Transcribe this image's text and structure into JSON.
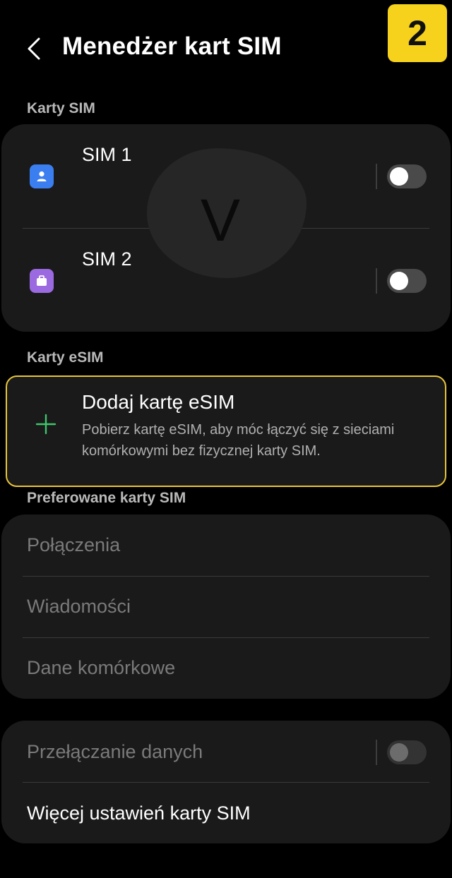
{
  "header": {
    "title": "Menedżer kart SIM",
    "step_badge": "2",
    "back_icon": "chevron-left-icon"
  },
  "colors": {
    "background": "#000000",
    "card": "#1a1a1a",
    "badge": "#f7d21c",
    "highlight_border": "#e8c53a",
    "sim1_icon": "#3b7ef0",
    "sim2_icon": "#9b6ae0",
    "plus": "#3fc56a"
  },
  "sim_section": {
    "label": "Karty SIM",
    "items": [
      {
        "name": "SIM 1",
        "icon": "person-sim-icon",
        "enabled": false
      },
      {
        "name": "SIM 2",
        "icon": "briefcase-sim-icon",
        "enabled": false
      }
    ],
    "overlay_letter": "V"
  },
  "esim_section": {
    "label": "Karty eSIM",
    "add_title": "Dodaj kartę eSIM",
    "add_description": "Pobierz kartę eSIM, aby móc łączyć się z sieciami komórkowymi bez fizycznej karty SIM.",
    "add_icon": "plus-icon"
  },
  "preferred_section": {
    "label": "Preferowane karty SIM",
    "items": [
      "Połączenia",
      "Wiadomości",
      "Dane komórkowe"
    ]
  },
  "other": {
    "data_switching": "Przełączanie danych",
    "data_switching_enabled": false,
    "more_settings": "Więcej ustawień karty SIM"
  }
}
